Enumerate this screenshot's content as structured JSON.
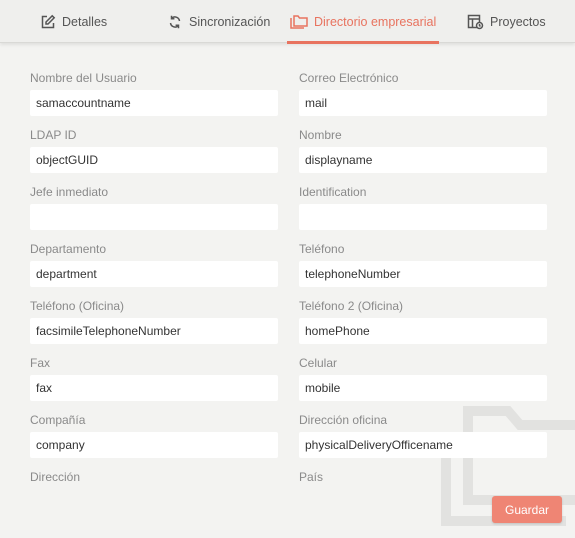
{
  "tabs": {
    "detalles": {
      "label": "Detalles",
      "icon": "edit-icon"
    },
    "sincronizacion": {
      "label": "Sincronización",
      "icon": "sync-icon"
    },
    "directorio": {
      "label": "Directorio empresarial",
      "icon": "folders-icon",
      "active": true
    },
    "proyectos": {
      "label": "Proyectos",
      "icon": "project-board-icon"
    }
  },
  "accent_color": "#e8735f",
  "fields": {
    "nombre_usuario": {
      "label": "Nombre del Usuario",
      "value": "samaccountname"
    },
    "correo": {
      "label": "Correo Electrónico",
      "value": "mail"
    },
    "ldap_id": {
      "label": "LDAP ID",
      "value": "objectGUID"
    },
    "nombre": {
      "label": "Nombre",
      "value": "displayname"
    },
    "jefe": {
      "label": "Jefe inmediato",
      "value": ""
    },
    "identification": {
      "label": "Identification",
      "value": ""
    },
    "departamento": {
      "label": "Departamento",
      "value": "department"
    },
    "telefono": {
      "label": "Teléfono",
      "value": "telephoneNumber"
    },
    "telefono_oficina": {
      "label": "Teléfono (Oficina)",
      "value": "facsimileTelephoneNumber"
    },
    "telefono2_oficina": {
      "label": "Teléfono 2 (Oficina)",
      "value": "homePhone"
    },
    "fax": {
      "label": "Fax",
      "value": "fax"
    },
    "celular": {
      "label": "Celular",
      "value": "mobile"
    },
    "compania": {
      "label": "Compañía",
      "value": "company"
    },
    "direccion_oficina": {
      "label": "Dirección oficina",
      "value": "physicalDeliveryOfficename"
    },
    "direccion": {
      "label": "Dirección",
      "value": ""
    },
    "pais": {
      "label": "País",
      "value": ""
    }
  },
  "actions": {
    "save_label": "Guardar",
    "save_color": "#ef8574"
  }
}
